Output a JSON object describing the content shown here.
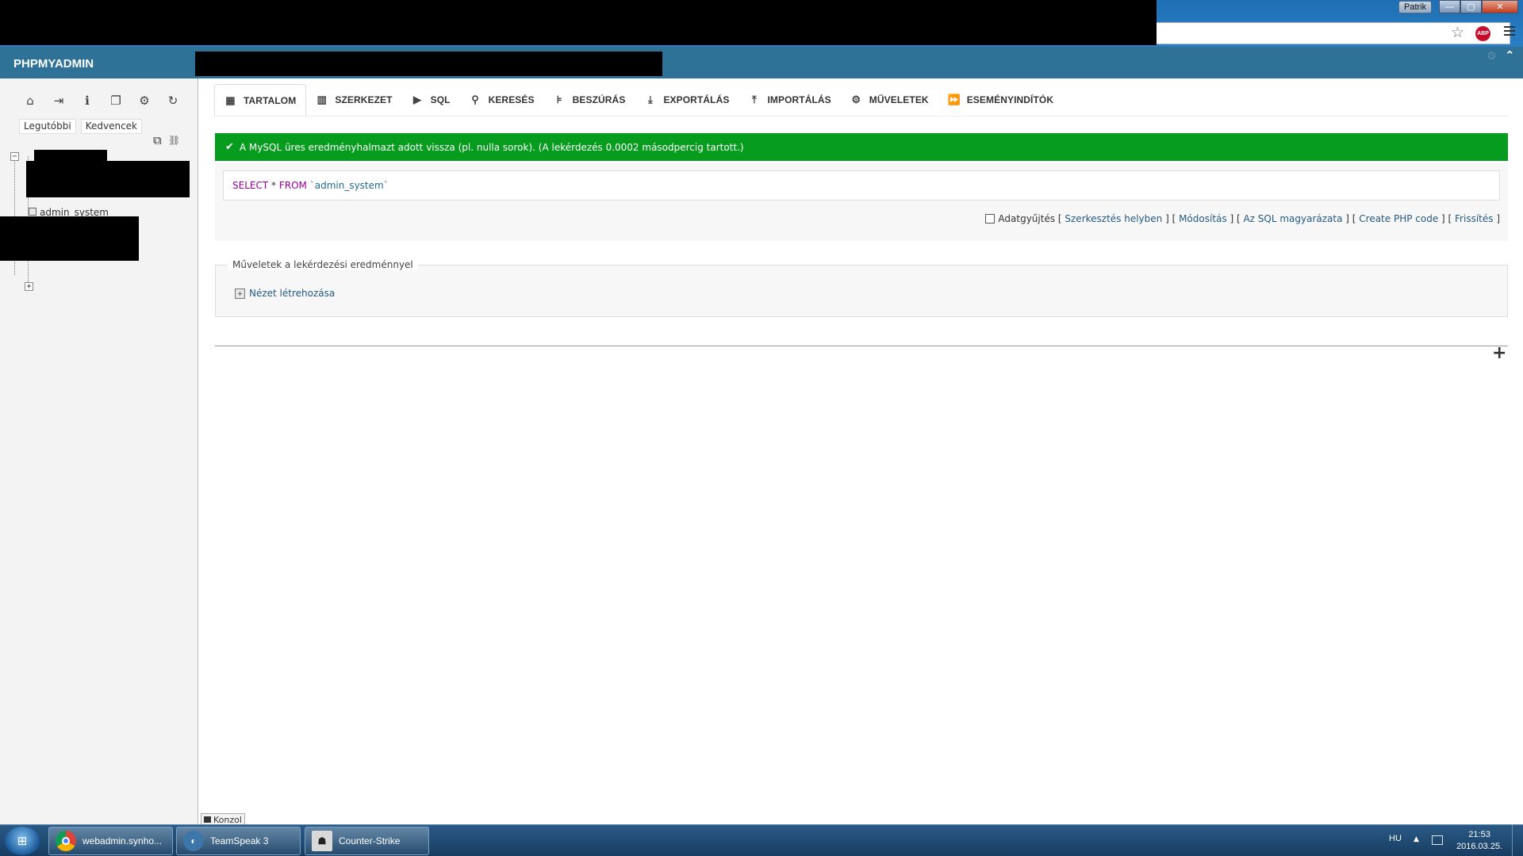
{
  "browser": {
    "user_badge": "Patrik",
    "win_min": "—",
    "win_max": "▢",
    "win_close": "✕",
    "abp_label": "ABP"
  },
  "pma": {
    "logo": "PHPMYADMIN"
  },
  "sidebar": {
    "nav_tabs": [
      "Legutóbbi",
      "Kedvencek"
    ],
    "tree_table": "admin_system"
  },
  "tabs": [
    {
      "label": "TARTALOM",
      "icon": "table-icon",
      "active": true
    },
    {
      "label": "SZERKEZET",
      "icon": "structure-icon"
    },
    {
      "label": "SQL",
      "icon": "sql-icon"
    },
    {
      "label": "KERESÉS",
      "icon": "search-icon"
    },
    {
      "label": "BESZÚRÁS",
      "icon": "insert-icon"
    },
    {
      "label": "EXPORTÁLÁS",
      "icon": "export-icon"
    },
    {
      "label": "IMPORTÁLÁS",
      "icon": "import-icon"
    },
    {
      "label": "MŰVELETEK",
      "icon": "gear-icon"
    },
    {
      "label": "ESEMÉNYINDÍTÓK",
      "icon": "triggers-icon"
    }
  ],
  "notice": {
    "text": "A MySQL üres eredményhalmazt adott vissza (pl. nulla sorok). (A lekérdezés 0.0002 másodpercig tartott.)",
    "color": "#069c1d"
  },
  "query": {
    "select": "SELECT",
    "star": "*",
    "from": "FROM",
    "table": "`admin_system`"
  },
  "query_options": {
    "profiling": "Adatgyűjtés",
    "edit_inline": "Szerkesztés helyben",
    "edit": "Módosítás",
    "explain": "Az SQL magyarázata",
    "php_code": "Create PHP code",
    "refresh": "Frissítés"
  },
  "operations": {
    "legend": "Műveletek a lekérdezési eredménnyel",
    "create_view": "Nézet létrehozása"
  },
  "console": {
    "label": "Konzol"
  },
  "taskbar": {
    "items": [
      "webadmin.synho...",
      "TeamSpeak 3",
      "Counter-Strike"
    ],
    "lang": "HU",
    "time": "21:53",
    "date": "2016.03.25."
  }
}
